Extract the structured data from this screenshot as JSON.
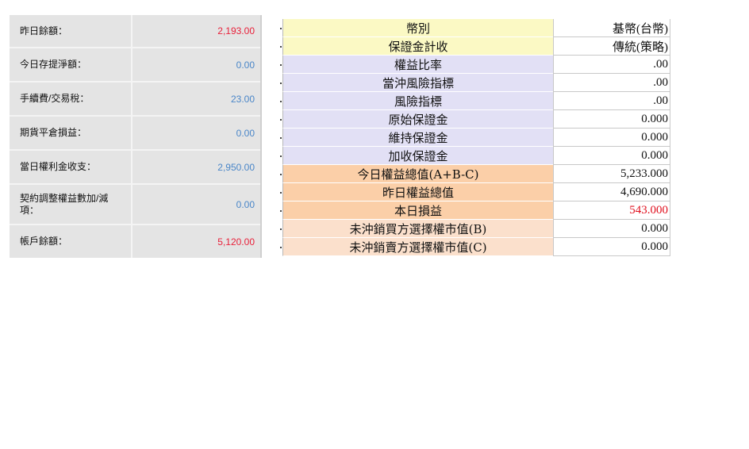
{
  "summary": {
    "rows": [
      {
        "label": "昨日餘額：",
        "value": "2,193.00",
        "color": "red"
      },
      {
        "label": "今日存提淨額：",
        "value": "0.00",
        "color": "blue"
      },
      {
        "label": "手續費/交易稅：",
        "value": "23.00",
        "color": "blue"
      },
      {
        "label": "期貨平倉損益：",
        "value": "0.00",
        "color": "blue"
      },
      {
        "label": "當日權利金收支：",
        "value": "2,950.00",
        "color": "blue"
      },
      {
        "label": "契約調整權益數加/減項：",
        "value": "0.00",
        "color": "blue"
      },
      {
        "label": "帳戶餘額：",
        "value": "5,120.00",
        "color": "red"
      }
    ]
  },
  "detail": {
    "rows": [
      {
        "label": "幣別",
        "value": "基幣(台幣)",
        "bg": "yellow"
      },
      {
        "label": "保證金計收",
        "value": "傳統(策略)",
        "bg": "yellow"
      },
      {
        "label": "權益比率",
        "value": ".00",
        "bg": "lavender"
      },
      {
        "label": "當沖風險指標",
        "value": ".00",
        "bg": "lavender"
      },
      {
        "label": "風險指標",
        "value": ".00",
        "bg": "lavender"
      },
      {
        "label": "原始保證金",
        "value": "0.000",
        "bg": "lavender"
      },
      {
        "label": "維持保證金",
        "value": "0.000",
        "bg": "lavender"
      },
      {
        "label": "加收保證金",
        "value": "0.000",
        "bg": "lavender"
      },
      {
        "label": "今日權益總值(A+B-C)",
        "value": "5,233.000",
        "bg": "orange"
      },
      {
        "label": "昨日權益總值",
        "value": "4,690.000",
        "bg": "orange"
      },
      {
        "label": "本日損益",
        "value": "543.000",
        "bg": "orange",
        "valueColor": "red"
      },
      {
        "label": "未沖銷買方選擇權市值(B)",
        "value": "0.000",
        "bg": "peach"
      },
      {
        "label": "未沖銷賣方選擇權市值(C)",
        "value": "0.000",
        "bg": "peach"
      }
    ]
  },
  "colors": {
    "summary_red": "#e8203a",
    "summary_blue": "#4a86c8",
    "yellow": "#fbf9c4",
    "lavender": "#e2e0f5",
    "orange": "#fbcfa8",
    "peach": "#fbe0cc"
  }
}
